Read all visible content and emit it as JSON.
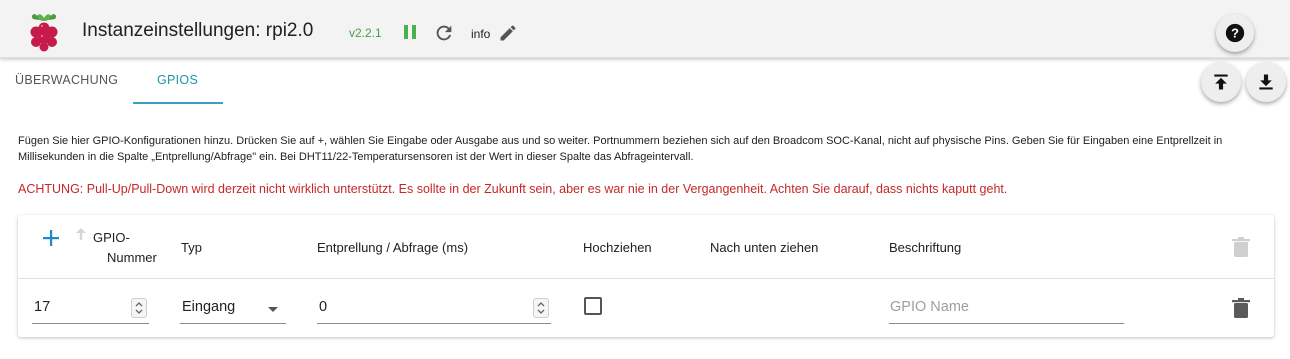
{
  "header": {
    "title": "Instanzeinstellungen: rpi2.0",
    "version": "v2.2.1",
    "info_label": "info",
    "logo_icon": "raspberry-pi-logo",
    "pause_icon": "pause-icon",
    "reload_icon": "reload-icon",
    "edit_icon": "pencil-icon",
    "help_icon": "help-icon"
  },
  "colors": {
    "version_green": "#43a047",
    "accent": "#2196a8",
    "warning_red": "#c62828"
  },
  "tabs": [
    {
      "label": "ÜBERWACHUNG",
      "active": false
    },
    {
      "label": "GPIOS",
      "active": true
    }
  ],
  "toolbar": {
    "upload_icon": "upload-icon",
    "download_icon": "download-icon"
  },
  "description": "Fügen Sie hier GPIO-Konfigurationen hinzu. Drücken Sie auf +, wählen Sie Eingabe oder Ausgabe aus und so weiter. Portnummern beziehen sich auf den Broadcom SOC-Kanal, nicht auf physische Pins. Geben Sie für Eingaben eine Entprellzeit in Millisekunden in die Spalte „Entprellung/Abfrage\" ein. Bei DHT11/22-Temperatursensoren ist der Wert in dieser Spalte das Abfrageintervall.",
  "warning": "ACHTUNG: Pull-Up/Pull-Down wird derzeit nicht wirklich unterstützt. Es sollte in der Zukunft sein, aber es war nie in der Vergangenheit. Achten Sie darauf, dass nichts kaputt geht.",
  "table": {
    "columns": {
      "gpio_line1": "GPIO-",
      "gpio_line2": "Nummer",
      "typ": "Typ",
      "entprellung": "Entprellung / Abfrage (ms)",
      "hochziehen": "Hochziehen",
      "nach_unten": "Nach unten ziehen",
      "beschriftung": "Beschriftung"
    },
    "rows": [
      {
        "gpio": "17",
        "typ": "Eingang",
        "entprellung": "0",
        "hochziehen": false,
        "name_placeholder": "GPIO Name"
      }
    ]
  }
}
